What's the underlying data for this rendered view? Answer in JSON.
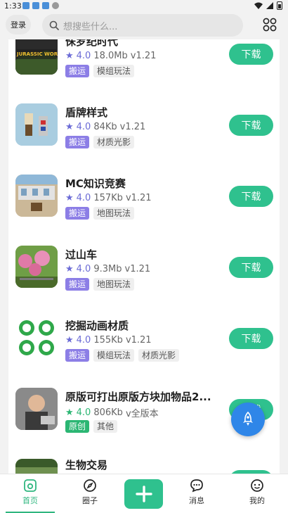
{
  "status_bar": {
    "time": "1:33"
  },
  "header": {
    "login_label": "登录",
    "search_placeholder": "想搜些什么..."
  },
  "apps": [
    {
      "title": "侏罗纪时代",
      "rating": "4.0",
      "size": "18.0Mb",
      "version": "v1.21",
      "tags": [
        "搬运",
        "模组玩法"
      ],
      "download_label": "下载",
      "thumb_text": "JURASSIC WORLD"
    },
    {
      "title": "盾牌样式",
      "rating": "4.0",
      "size": "84Kb",
      "version": "v1.21",
      "tags": [
        "搬运",
        "材质光影"
      ],
      "download_label": "下载"
    },
    {
      "title": "MC知识竞赛",
      "rating": "4.0",
      "size": "157Kb",
      "version": "v1.21",
      "tags": [
        "搬运",
        "地图玩法"
      ],
      "download_label": "下载"
    },
    {
      "title": "过山车",
      "rating": "4.0",
      "size": "9.3Mb",
      "version": "v1.21",
      "tags": [
        "搬运",
        "地图玩法"
      ],
      "download_label": "下载"
    },
    {
      "title": "挖掘动画材质",
      "rating": "4.0",
      "size": "155Kb",
      "version": "v1.21",
      "tags": [
        "搬运",
        "模组玩法",
        "材质光影"
      ],
      "download_label": "下载"
    },
    {
      "title": "原版可打出原版方块加物品2...",
      "rating": "4.0",
      "size": "806Kb",
      "version": "v全版本",
      "tags": [
        "原创",
        "其他"
      ],
      "download_label": "下载"
    },
    {
      "title": "生物交易",
      "rating": "",
      "size": "",
      "version": "",
      "tags": [],
      "download_label": ""
    }
  ],
  "bottom_nav": [
    {
      "label": "首页",
      "icon": "home-icon"
    },
    {
      "label": "圈子",
      "icon": "compass-icon"
    },
    {
      "label": "",
      "icon": "plus-icon"
    },
    {
      "label": "消息",
      "icon": "chat-icon"
    },
    {
      "label": "我的",
      "icon": "profile-icon"
    }
  ],
  "colors": {
    "accent": "#2fc18e",
    "carry_tag": "#8c7ee6",
    "original_tag": "#2bb673",
    "rocket": "#2f86e8",
    "star": "#6b6bd6"
  }
}
